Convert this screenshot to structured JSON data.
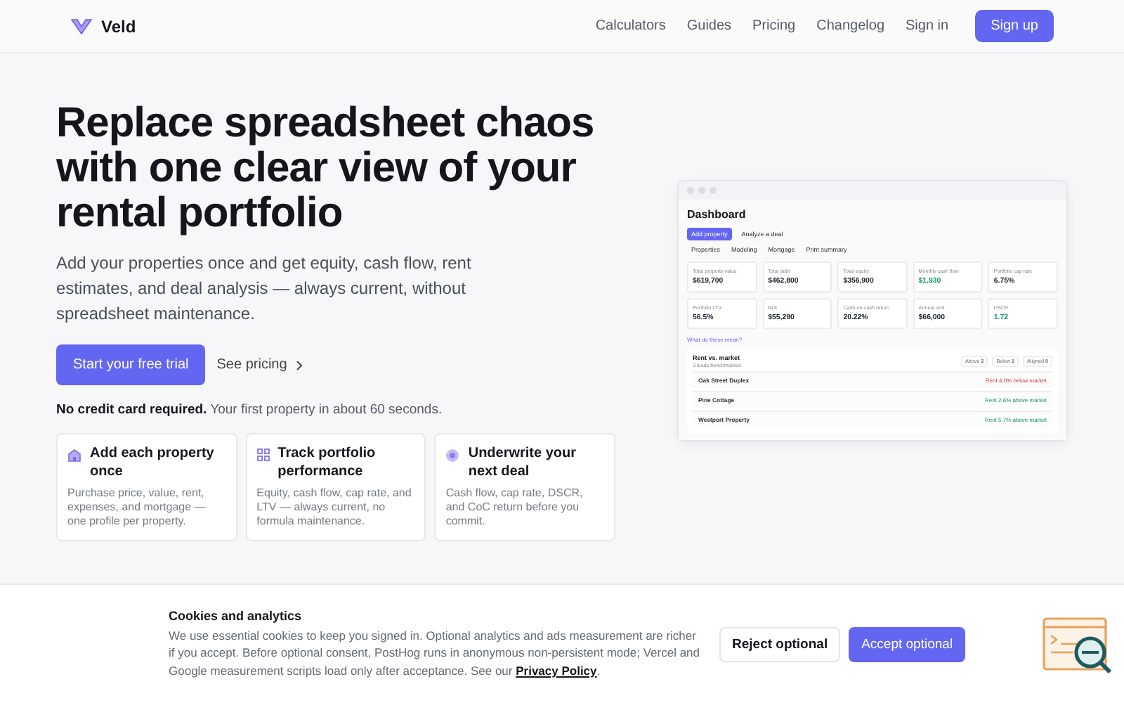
{
  "nav": {
    "brand": "Veld",
    "links": [
      "Calculators",
      "Guides",
      "Pricing",
      "Changelog",
      "Sign in"
    ],
    "cta": "Sign up"
  },
  "hero": {
    "title": "Replace spreadsheet chaos with one clear view of your rental portfolio",
    "subtitle": "Add your properties once and get equity, cash flow, rent estimates, and deal analysis — always current, without spreadsheet maintenance.",
    "primary_button": "Start your free trial",
    "secondary_link": "See pricing",
    "note": "**No credit card required.** Your first property in about 60 seconds."
  },
  "features": [
    {
      "title": "Add each property once",
      "body": "Purchase price, value, rent, expenses, and mortgage — one profile per property."
    },
    {
      "title": "Track portfolio performance",
      "body": "Equity, cash flow, cap rate, and LTV — always current, no formula maintenance."
    },
    {
      "title": "Underwrite your next deal",
      "body": "Cash flow, cap rate, DSCR, and CoC return before you commit."
    }
  ],
  "dashboard": {
    "title": "Dashboard",
    "actions": [
      {
        "label": "Add property",
        "kind": "primary"
      },
      {
        "label": "Analyze a deal",
        "kind": "plain"
      }
    ],
    "tabs": [
      "Properties",
      "Modeling",
      "Mortgage",
      "Print summary"
    ],
    "metrics": [
      {
        "label": "Total property value",
        "value": "$619,700",
        "kind": "neutral"
      },
      {
        "label": "Total debt",
        "value": "$462,800",
        "kind": "neutral"
      },
      {
        "label": "Total equity",
        "value": "$356,900",
        "kind": "neutral"
      },
      {
        "label": "Monthly cash flow",
        "value": "$1,930",
        "kind": "positive"
      },
      {
        "label": "Portfolio cap rate",
        "value": "6.75%",
        "kind": "neutral"
      },
      {
        "label": "Portfolio LTV",
        "value": "56.5%",
        "kind": "neutral"
      },
      {
        "label": "NOI",
        "value": "$55,290",
        "kind": "neutral"
      },
      {
        "label": "Cash-on-cash return",
        "value": "20.22%",
        "kind": "neutral"
      },
      {
        "label": "Annual rent",
        "value": "$66,000",
        "kind": "neutral"
      },
      {
        "label": "DSCR",
        "value": "1.72",
        "kind": "positive"
      }
    ],
    "help_link": "What do these mean?",
    "rent": {
      "title": "Rent vs. market",
      "subtitle": "3 leads benchmarked",
      "counts": [
        {
          "label": "Above",
          "count": "2"
        },
        {
          "label": "Below",
          "count": "1"
        },
        {
          "label": "Aligned",
          "count": "0"
        }
      ],
      "rows": [
        {
          "name": "Oak Street Duplex",
          "status": "Rent 4.0% below market",
          "kind": "below"
        },
        {
          "name": "Pine Cottage",
          "status": "Rent 2.6% above market",
          "kind": "above"
        },
        {
          "name": "Westport Property",
          "status": "Rent 5.7% above market",
          "kind": "above"
        }
      ]
    }
  },
  "cookies": {
    "title": "Cookies and analytics",
    "text": "We use essential cookies to keep you signed in. Optional analytics and ads measurement are richer if you accept. Before optional consent, PostHog runs in anonymous non-persistent mode; Vercel and Google measurement scripts load only after acceptance. See our",
    "link": "Privacy Policy",
    "end": ".",
    "reject": "Reject optional",
    "accept": "Accept optional"
  }
}
